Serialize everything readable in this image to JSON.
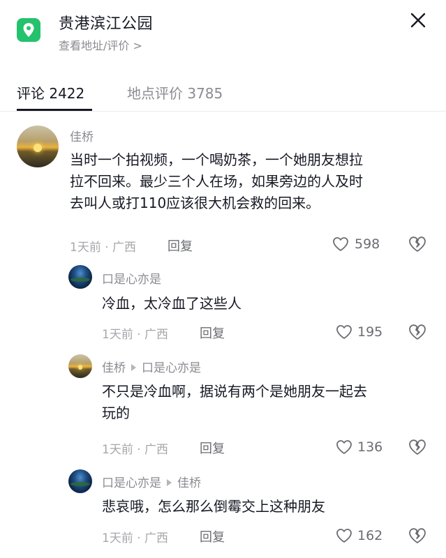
{
  "header": {
    "title": "贵港滨江公园",
    "subtitle": "查看地址/评价 >",
    "location_icon": "map-pin-icon",
    "close_icon": "close-icon"
  },
  "tabs": [
    {
      "label": "评论 2422",
      "active": true
    },
    {
      "label": "地点评价 3785",
      "active": false
    }
  ],
  "comments": [
    {
      "username": "佳桥",
      "avatar": "sunset",
      "text_lines": [
        "当时一个拍视频，一个喝奶茶，一个她朋友想拉",
        "拉不回来。最少三个人在场，如果旁边的人及时",
        "去叫人或打110应该很大机会救的回来。"
      ],
      "meta": "1天前 · 广西",
      "reply_label": "回复",
      "likes": "598"
    },
    {
      "username": "口是心亦是",
      "avatar": "night",
      "text_lines": [
        "冷血，太冷血了这些人"
      ],
      "meta": "1天前 · 广西",
      "reply_label": "回复",
      "likes": "195"
    },
    {
      "username": "佳桥",
      "reply_to": "口是心亦是",
      "avatar": "sunset",
      "text_lines": [
        "不只是冷血啊，据说有两个是她朋友一起去",
        "玩的"
      ],
      "meta": "1天前 · 广西",
      "reply_label": "回复",
      "likes": "136"
    },
    {
      "username": "口是心亦是",
      "reply_to": "佳桥",
      "avatar": "night",
      "text_lines": [
        "悲哀哦，怎么那么倒霉交上这种朋友"
      ],
      "meta": "1天前 · 广西",
      "reply_label": "回复",
      "likes": "162"
    }
  ],
  "colors": {
    "accent_green": "#25c26e",
    "text_primary": "#161823",
    "text_secondary": "#8a8b91"
  }
}
